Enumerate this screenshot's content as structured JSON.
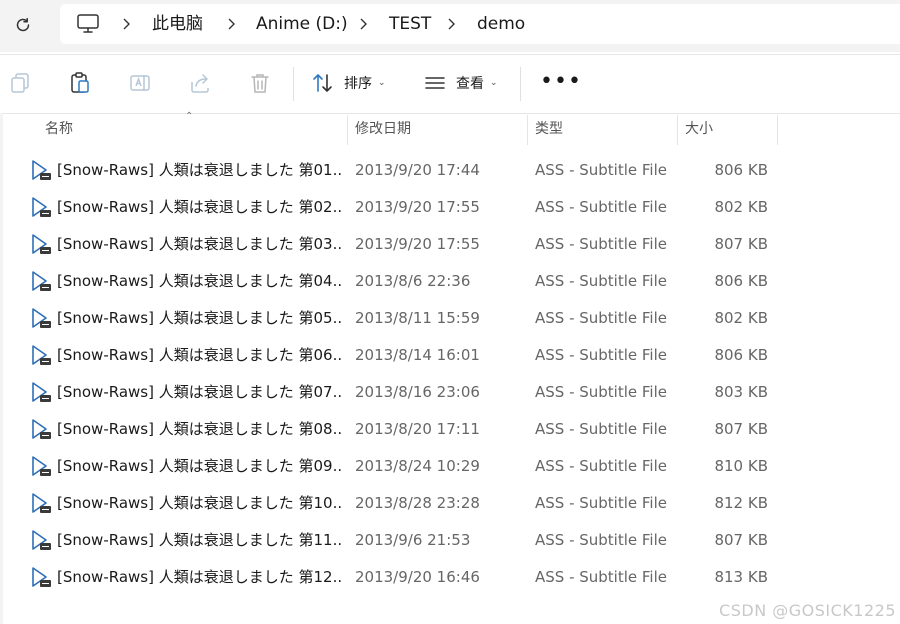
{
  "breadcrumb": {
    "items": [
      "此电脑",
      "Anime (D:)",
      "TEST",
      "demo"
    ]
  },
  "toolbar": {
    "sort_label": "排序",
    "view_label": "查看",
    "more_label": "•••"
  },
  "columns": {
    "name": "名称",
    "date": "修改日期",
    "type": "类型",
    "size": "大小"
  },
  "files": [
    {
      "name": "[Snow-Raws] 人類は衰退しました 第01...",
      "date": "2013/9/20 17:44",
      "type": "ASS - Subtitle File",
      "size": "806 KB"
    },
    {
      "name": "[Snow-Raws] 人類は衰退しました 第02...",
      "date": "2013/9/20 17:55",
      "type": "ASS - Subtitle File",
      "size": "802 KB"
    },
    {
      "name": "[Snow-Raws] 人類は衰退しました 第03...",
      "date": "2013/9/20 17:55",
      "type": "ASS - Subtitle File",
      "size": "807 KB"
    },
    {
      "name": "[Snow-Raws] 人類は衰退しました 第04...",
      "date": "2013/8/6 22:36",
      "type": "ASS - Subtitle File",
      "size": "806 KB"
    },
    {
      "name": "[Snow-Raws] 人類は衰退しました 第05...",
      "date": "2013/8/11 15:59",
      "type": "ASS - Subtitle File",
      "size": "802 KB"
    },
    {
      "name": "[Snow-Raws] 人類は衰退しました 第06...",
      "date": "2013/8/14 16:01",
      "type": "ASS - Subtitle File",
      "size": "806 KB"
    },
    {
      "name": "[Snow-Raws] 人類は衰退しました 第07...",
      "date": "2013/8/16 23:06",
      "type": "ASS - Subtitle File",
      "size": "803 KB"
    },
    {
      "name": "[Snow-Raws] 人類は衰退しました 第08...",
      "date": "2013/8/20 17:11",
      "type": "ASS - Subtitle File",
      "size": "807 KB"
    },
    {
      "name": "[Snow-Raws] 人類は衰退しました 第09...",
      "date": "2013/8/24 10:29",
      "type": "ASS - Subtitle File",
      "size": "810 KB"
    },
    {
      "name": "[Snow-Raws] 人類は衰退しました 第10...",
      "date": "2013/8/28 23:28",
      "type": "ASS - Subtitle File",
      "size": "812 KB"
    },
    {
      "name": "[Snow-Raws] 人類は衰退しました 第11...",
      "date": "2013/9/6 21:53",
      "type": "ASS - Subtitle File",
      "size": "807 KB"
    },
    {
      "name": "[Snow-Raws] 人類は衰退しました 第12...",
      "date": "2013/9/20 16:46",
      "type": "ASS - Subtitle File",
      "size": "813 KB"
    }
  ],
  "watermark": "CSDN @GOSICK1225"
}
